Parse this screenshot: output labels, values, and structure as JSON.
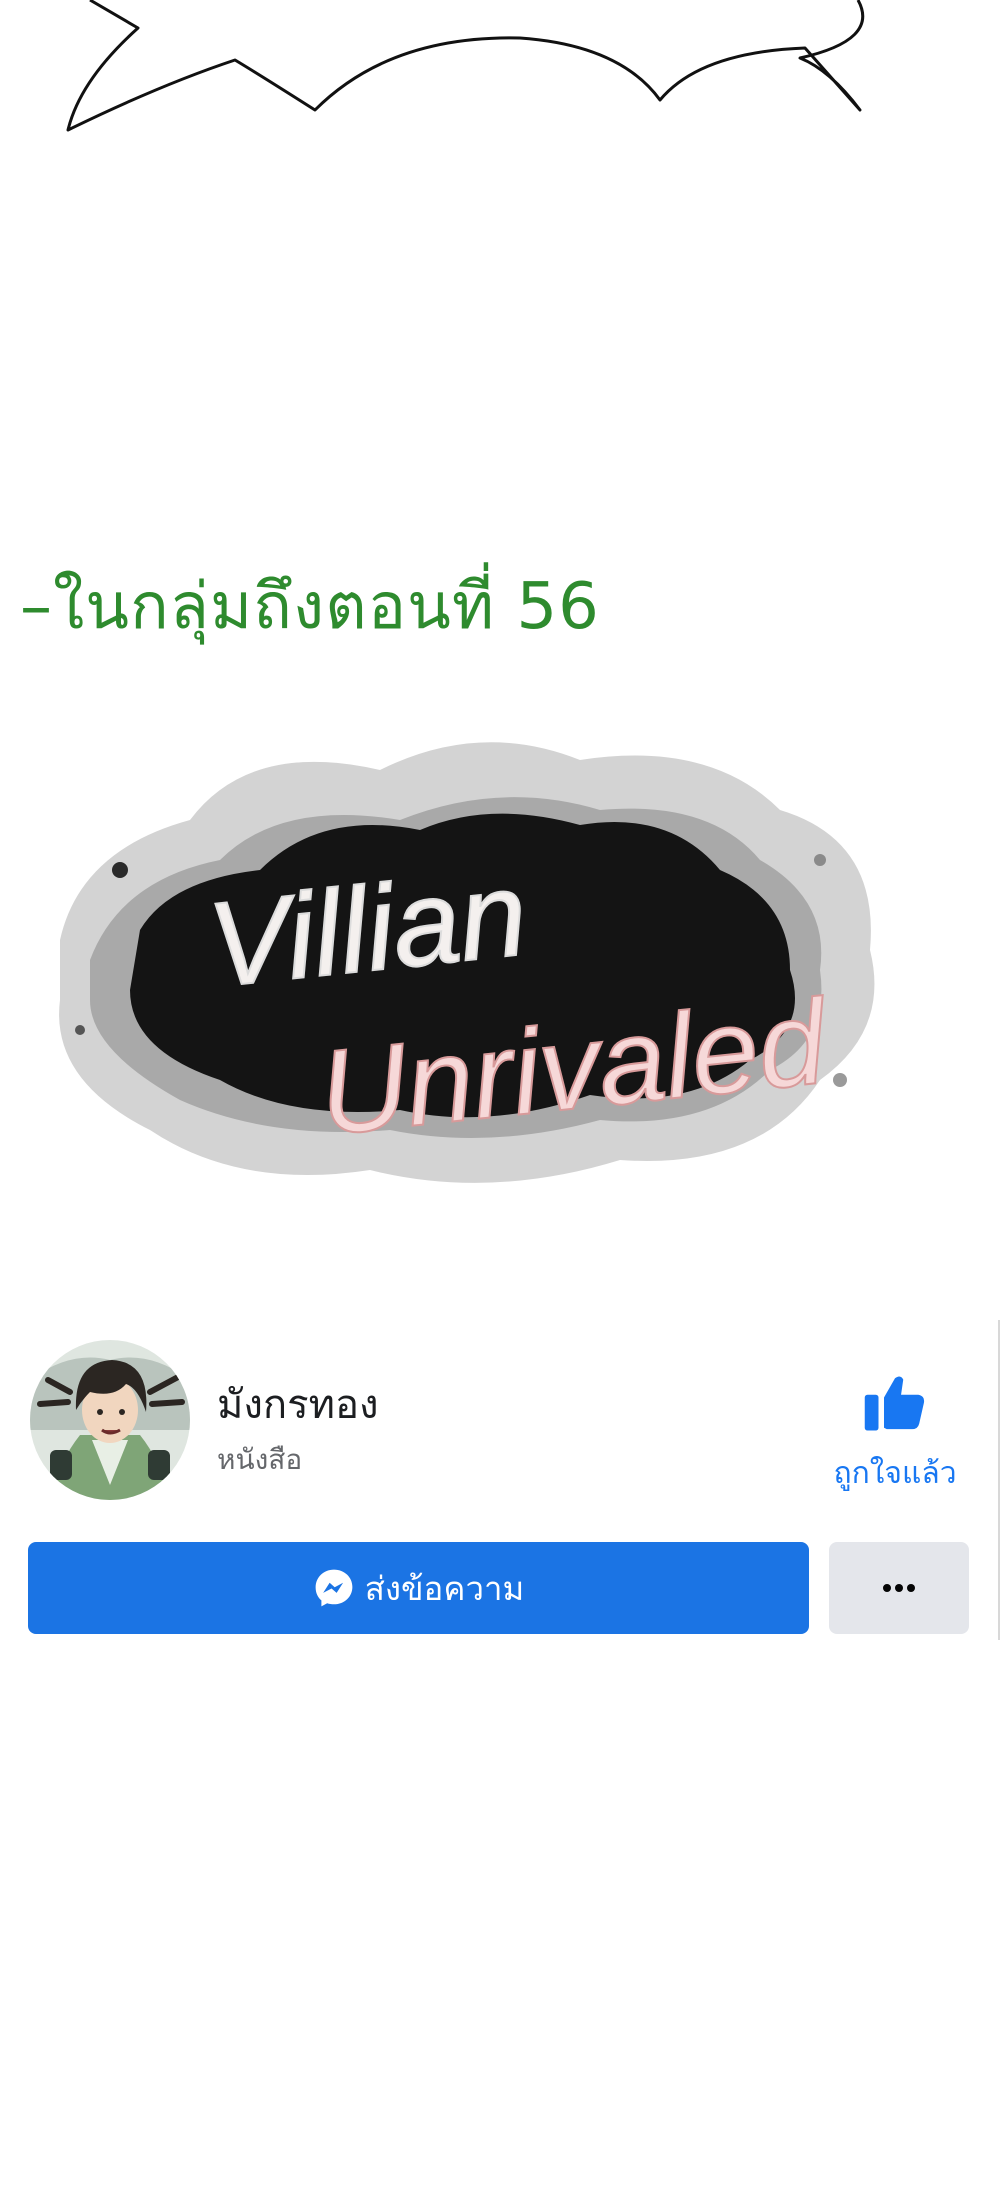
{
  "announcement": {
    "text": "–ในกลุ่มถึงตอนที่ 56"
  },
  "logo": {
    "line1": "Villian",
    "line2": "Unrivaled"
  },
  "profile": {
    "name": "มังกรทอง",
    "category": "หนังสือ",
    "avatar_icon": "avatar-image",
    "like_icon": "thumbs-up-icon",
    "like_label": "ถูกใจแล้ว",
    "message_icon": "messenger-icon",
    "message_label": "ส่งข้อความ",
    "more_icon": "more-dots-icon",
    "colors": {
      "like_blue": "#1877f2",
      "button_blue": "#1b74e4",
      "secondary_button": "#e4e6eb",
      "announcement_green": "#2e8b2e"
    }
  }
}
